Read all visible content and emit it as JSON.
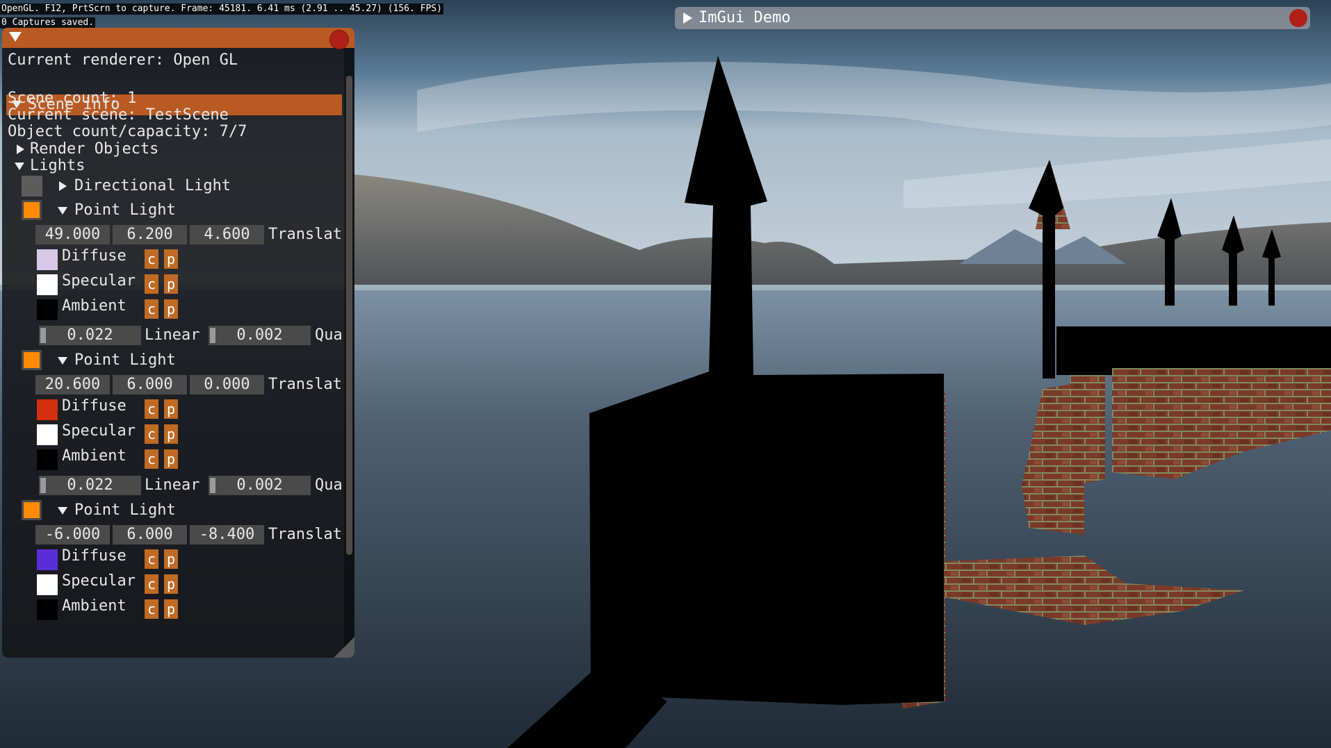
{
  "overlay": {
    "status": "OpenGL. F12, PrtScrn to capture. Frame: 45181. 6.41 ms (2.91 .. 45.27) (156. FPS)",
    "captures": "0 Captures saved."
  },
  "demo_window": {
    "title": "ImGui Demo"
  },
  "inspector": {
    "renderer": "Current renderer: Open GL",
    "scene_header": "Scene info",
    "scene_count": "Scene count: 1",
    "current_scene": "Current scene: TestScene",
    "object_count": "Object count/capacity: 7/7",
    "render_objects": "Render Objects",
    "lights": "Lights",
    "directional_light": "Directional Light",
    "point_lights": [
      {
        "label": "Point Light",
        "tx": "49.000",
        "ty": "6.200",
        "tz": "4.600",
        "translate_label": "Translat",
        "diffuse": "Diffuse",
        "specular": "Specular",
        "ambient": "Ambient",
        "diffuse_color": "#d8c8e8",
        "specular_color": "#ffffff",
        "ambient_color": "#000000",
        "linear": "0.022",
        "linear_label": "Linear",
        "quadratic": "0.002",
        "quadratic_label": "Qua"
      },
      {
        "label": "Point Light",
        "tx": "20.600",
        "ty": "6.000",
        "tz": "0.000",
        "translate_label": "Translat",
        "diffuse": "Diffuse",
        "specular": "Specular",
        "ambient": "Ambient",
        "diffuse_color": "#d2300e",
        "specular_color": "#ffffff",
        "ambient_color": "#000000",
        "linear": "0.022",
        "linear_label": "Linear",
        "quadratic": "0.002",
        "quadratic_label": "Qua"
      },
      {
        "label": "Point Light",
        "tx": "-6.000",
        "ty": "6.000",
        "tz": "-8.400",
        "translate_label": "Translat",
        "diffuse": "Diffuse",
        "specular": "Specular",
        "ambient": "Ambient",
        "diffuse_color": "#5a2ed6",
        "specular_color": "#ffffff",
        "ambient_color": "#000000"
      }
    ],
    "copy_button": "c",
    "paste_button": "p"
  },
  "colors": {
    "accent": "#b95a23",
    "light_swatch": "#ff8a00"
  }
}
